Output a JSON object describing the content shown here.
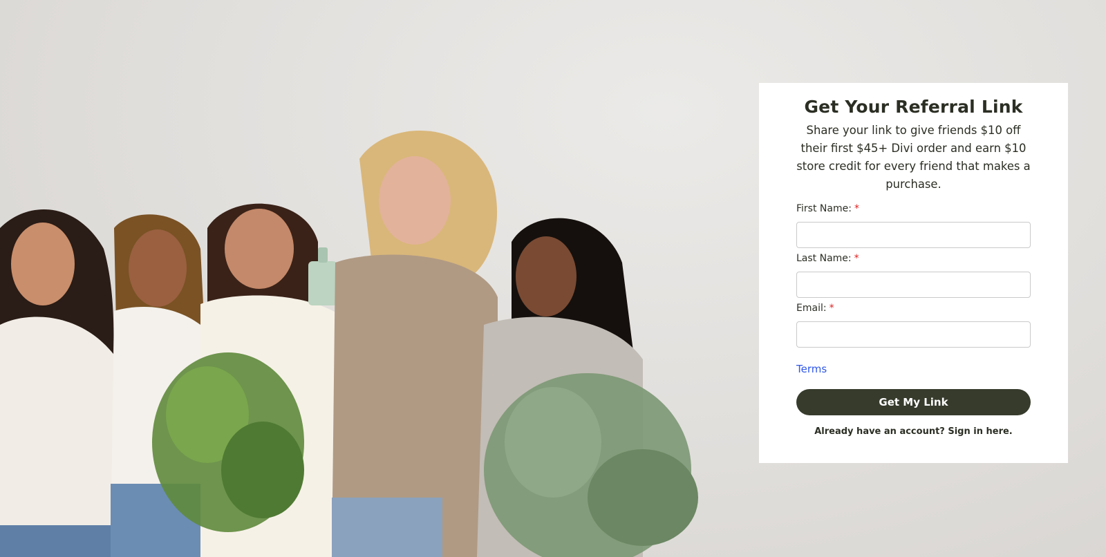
{
  "hero": {
    "image_icon": "group-photo-women-with-greenery"
  },
  "form": {
    "title": "Get Your Referral Link",
    "subtitle": "Share your link to give friends $10 off their first $45+ Divi order and earn $10 store credit for every friend that makes a purchase.",
    "fields": [
      {
        "label": "First Name:",
        "required_mark": "*",
        "value": "",
        "placeholder": ""
      },
      {
        "label": "Last Name:",
        "required_mark": "*",
        "value": "",
        "placeholder": ""
      },
      {
        "label": "Email:",
        "required_mark": "*",
        "value": "",
        "placeholder": ""
      }
    ],
    "terms_label": "Terms",
    "submit_label": "Get My Link",
    "signin_text": "Already have an account? Sign in here."
  },
  "colors": {
    "button_bg": "#363b2c",
    "link": "#2f57e8",
    "required": "#e02020",
    "text": "#2b2e23"
  }
}
